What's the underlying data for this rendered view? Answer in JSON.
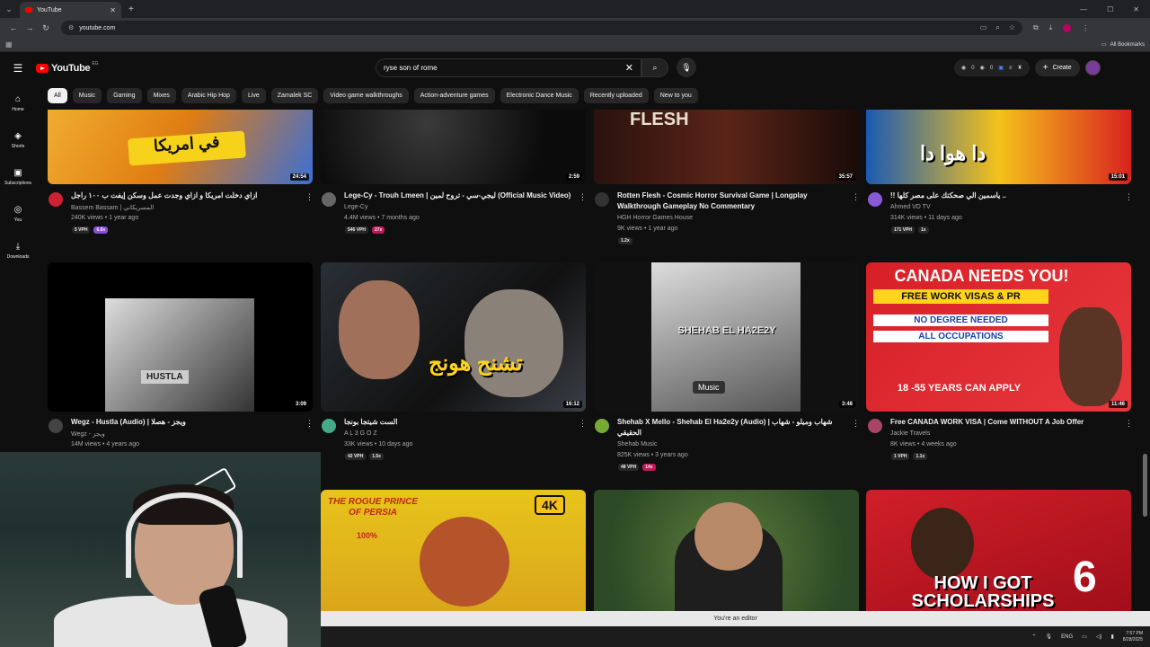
{
  "browser": {
    "tab_title": "YouTube",
    "url": "youtube.com",
    "all_bookmarks": "All Bookmarks"
  },
  "header": {
    "logo_text": "YouTube",
    "country_code": "EG",
    "search_value": "ryse son of rome",
    "stat_a": "0",
    "stat_b": "0",
    "create_label": "Create"
  },
  "chips": [
    "All",
    "Music",
    "Gaming",
    "Mixes",
    "Arabic Hip Hop",
    "Live",
    "Zamalek SC",
    "Video game walkthroughs",
    "Action-adventure games",
    "Electronic Dance Music",
    "Recently uploaded",
    "New to you"
  ],
  "sidebar": [
    {
      "label": "Home",
      "icon": "home-icon"
    },
    {
      "label": "Shorts",
      "icon": "shorts-icon"
    },
    {
      "label": "Subscriptions",
      "icon": "subscriptions-icon"
    },
    {
      "label": "You",
      "icon": "you-icon"
    },
    {
      "label": "Downloads",
      "icon": "downloads-icon"
    }
  ],
  "videos": [
    {
      "title": "ازاي دخلت امريكا و ازاي وجدت عمل وسكن إيفت ب ١٠٠ راجل",
      "channel": "Bassem Bassam | المسريكاني",
      "stats": "240K views • 1 year ago",
      "duration": "24:54",
      "badges": [
        "5 VPH",
        "6.8x"
      ],
      "thumb_text": "في امريكا"
    },
    {
      "title": "Lege-Cy - Trouh Lmeen | ليجي-سي - تروح لمين (Official Music Video)",
      "channel": "Lege-Cy",
      "stats": "4.4M views • 7 months ago",
      "duration": "2:59",
      "badges": [
        "546 VPH",
        "27x"
      ],
      "thumb_text": ""
    },
    {
      "title": "Rotten Flesh - Cosmic Horror Survival Game | Longplay Walkthrough Gameplay No Commentary",
      "channel": "HGH Horror Games House",
      "stats": "9K views • 1 year ago",
      "duration": "35:57",
      "badges": [
        "1.2x"
      ],
      "thumb_text": "FLESH"
    },
    {
      "title": "!! ياسمين الي صحكتك على مصر كلها ..",
      "channel": "Ahmed VD TV",
      "stats": "314K views • 11 days ago",
      "duration": "15:01",
      "badges": [
        "171 VPH",
        "1x"
      ],
      "thumb_text": "دا هوا دا"
    },
    {
      "title": "Wegz - Hustla (Audio) | ويجز - هصلا",
      "channel": "Wegz - ويجز",
      "stats": "14M views • 4 years ago",
      "duration": "3:09",
      "badges": [],
      "thumb_text": "HUSTLA"
    },
    {
      "title": "الست شيتجا بونجا",
      "channel": "A L 3 G O Z",
      "stats": "33K views • 10 days ago",
      "duration": "16:12",
      "badges": [
        "42 VPH",
        "1.5x"
      ],
      "thumb_text": "تشنح هونج"
    },
    {
      "title": "Shehab X Mello - Shehab El Ha2e2y (Audio) | شهاب وميلو - شهاب الحقيقي",
      "channel": "Shehab Music",
      "stats": "825K views • 3 years ago",
      "duration": "3:48",
      "badges": [
        "48 VPH",
        "14x"
      ],
      "thumb_text": "Music"
    },
    {
      "title": "Free CANADA WORK VISA | Come WITHOUT A Job Offer",
      "channel": "Jackie Travels",
      "stats": "8K views • 4 weeks ago",
      "duration": "11:46",
      "badges": [
        "1 VPH",
        "1.1x"
      ],
      "thumb_text": "CANADA NEEDS YOU!"
    }
  ],
  "thumb_extra": {
    "canada_lines": [
      "FREE WORK VISAS & PR",
      "NO DEGREE NEEDED",
      "ALL OCCUPATIONS",
      "18 -55 YEARS CAN APPLY"
    ],
    "prince_title": "THE ROGUE PRINCE OF PERSIA",
    "prince_badge": "4K",
    "prince_pct": "100%",
    "scholar_text": "HOW I GOT SCHOLARSHIPS",
    "scholar_num": "6",
    "shehab_art": "SHEHAB EL HA2E2Y"
  },
  "system": {
    "editor_notice": "You're an editor",
    "lang": "ENG",
    "time": "7:57 PM",
    "date": "8/28/2025"
  }
}
